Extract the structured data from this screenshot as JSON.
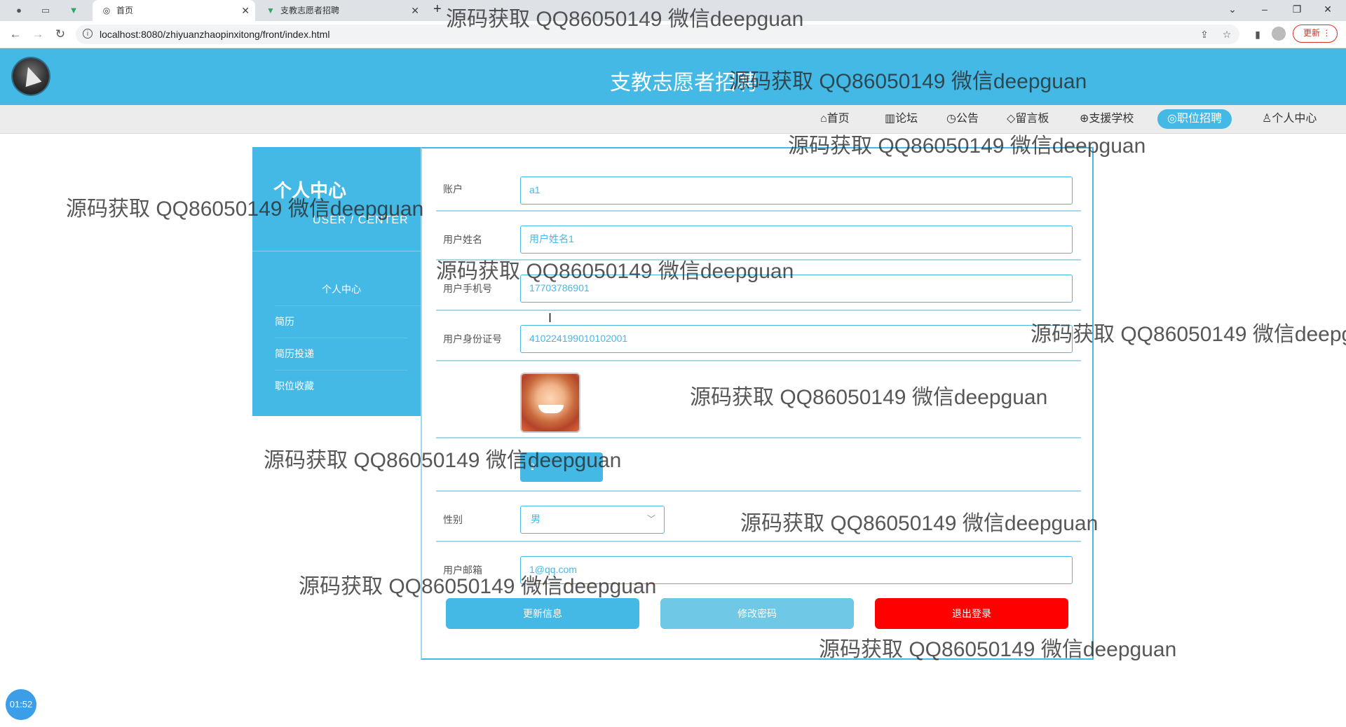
{
  "browser": {
    "tabs": [
      {
        "title": "首页",
        "icon": "globe-icon",
        "active": true
      },
      {
        "title": "支教志愿者招聘",
        "icon": "vue-icon",
        "active": false
      }
    ],
    "url": "localhost:8080/zhiyuanzhaopinxitong/front/index.html",
    "update_label": "更新"
  },
  "site": {
    "title": "支教志愿者招聘",
    "nav": [
      {
        "label": "首页",
        "icon": "home-icon"
      },
      {
        "label": "论坛",
        "icon": "forum-icon"
      },
      {
        "label": "公告",
        "icon": "clock-icon"
      },
      {
        "label": "留言板",
        "icon": "tag-icon"
      },
      {
        "label": "支援学校",
        "icon": "school-icon"
      },
      {
        "label": "职位招聘",
        "icon": "job-icon",
        "active": true
      },
      {
        "label": "个人中心",
        "icon": "user-icon"
      }
    ]
  },
  "sidebar": {
    "title": "个人中心",
    "subtitle": "USER / CENTER",
    "items": [
      {
        "label": "个人中心"
      },
      {
        "label": "简历"
      },
      {
        "label": "简历投递"
      },
      {
        "label": "职位收藏"
      }
    ]
  },
  "form": {
    "account": {
      "label": "账户",
      "value": "a1"
    },
    "name": {
      "label": "用户姓名",
      "value": "用户姓名1"
    },
    "phone": {
      "label": "用户手机号",
      "value": "17703786901"
    },
    "idcard": {
      "label": "用户身份证号",
      "value": "410224199010102001"
    },
    "gender": {
      "label": "性别",
      "value": "男"
    },
    "email": {
      "label": "用户邮箱",
      "value": "1@qq.com"
    },
    "buttons": {
      "update": "更新信息",
      "password": "修改密码",
      "logout": "退出登录"
    },
    "colors": {
      "primary": "#45b9e6",
      "light": "#6ec8e6",
      "danger": "#ff0000"
    }
  },
  "watermark": "源码获取 QQ86050149 微信deepguan",
  "recorder_timer": "01:52"
}
